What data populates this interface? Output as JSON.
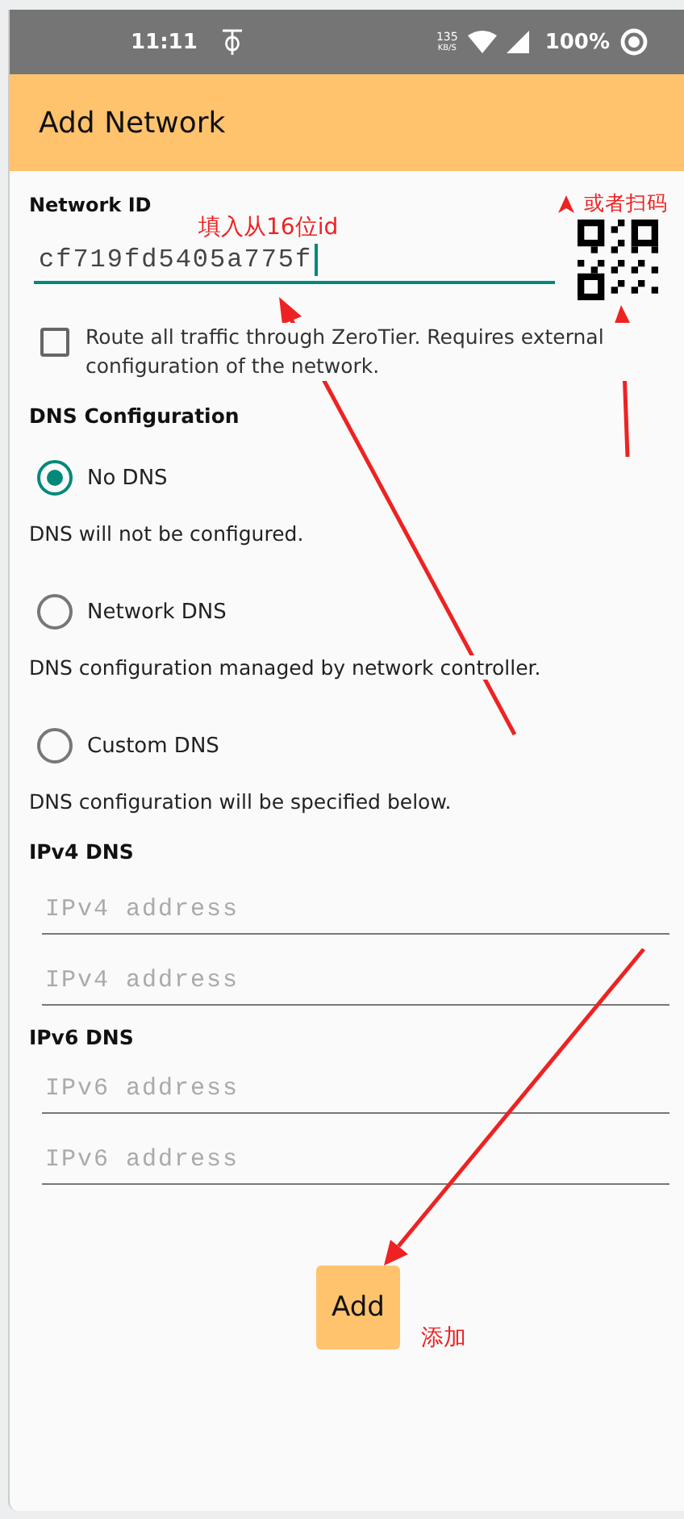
{
  "status_bar": {
    "time": "11:11",
    "speed": "135",
    "speed_unit": "KB/S",
    "battery": "100%"
  },
  "title": "Add Network",
  "network_id": {
    "label": "Network ID",
    "value": "cf719fd5405a775f"
  },
  "route_all": {
    "label": "Route all traffic through ZeroTier. Requires external configuration of the network.",
    "checked": false
  },
  "dns": {
    "heading": "DNS Configuration",
    "options": [
      {
        "label": "No DNS",
        "description": "DNS will not be configured.",
        "selected": true
      },
      {
        "label": "Network DNS",
        "description": "DNS configuration managed by network controller.",
        "selected": false
      },
      {
        "label": "Custom DNS",
        "description": "DNS configuration will be specified below.",
        "selected": false
      }
    ]
  },
  "ipv4": {
    "heading": "IPv4 DNS",
    "fields": [
      {
        "placeholder": "IPv4 address"
      },
      {
        "placeholder": "IPv4 address"
      }
    ]
  },
  "ipv6": {
    "heading": "IPv6 DNS",
    "fields": [
      {
        "placeholder": "IPv6 address"
      },
      {
        "placeholder": "IPv6 address"
      }
    ]
  },
  "button": "Add",
  "annotations": {
    "id_hint": "填入从16位id",
    "scan_hint": "或者扫码",
    "add_hint": "添加"
  }
}
